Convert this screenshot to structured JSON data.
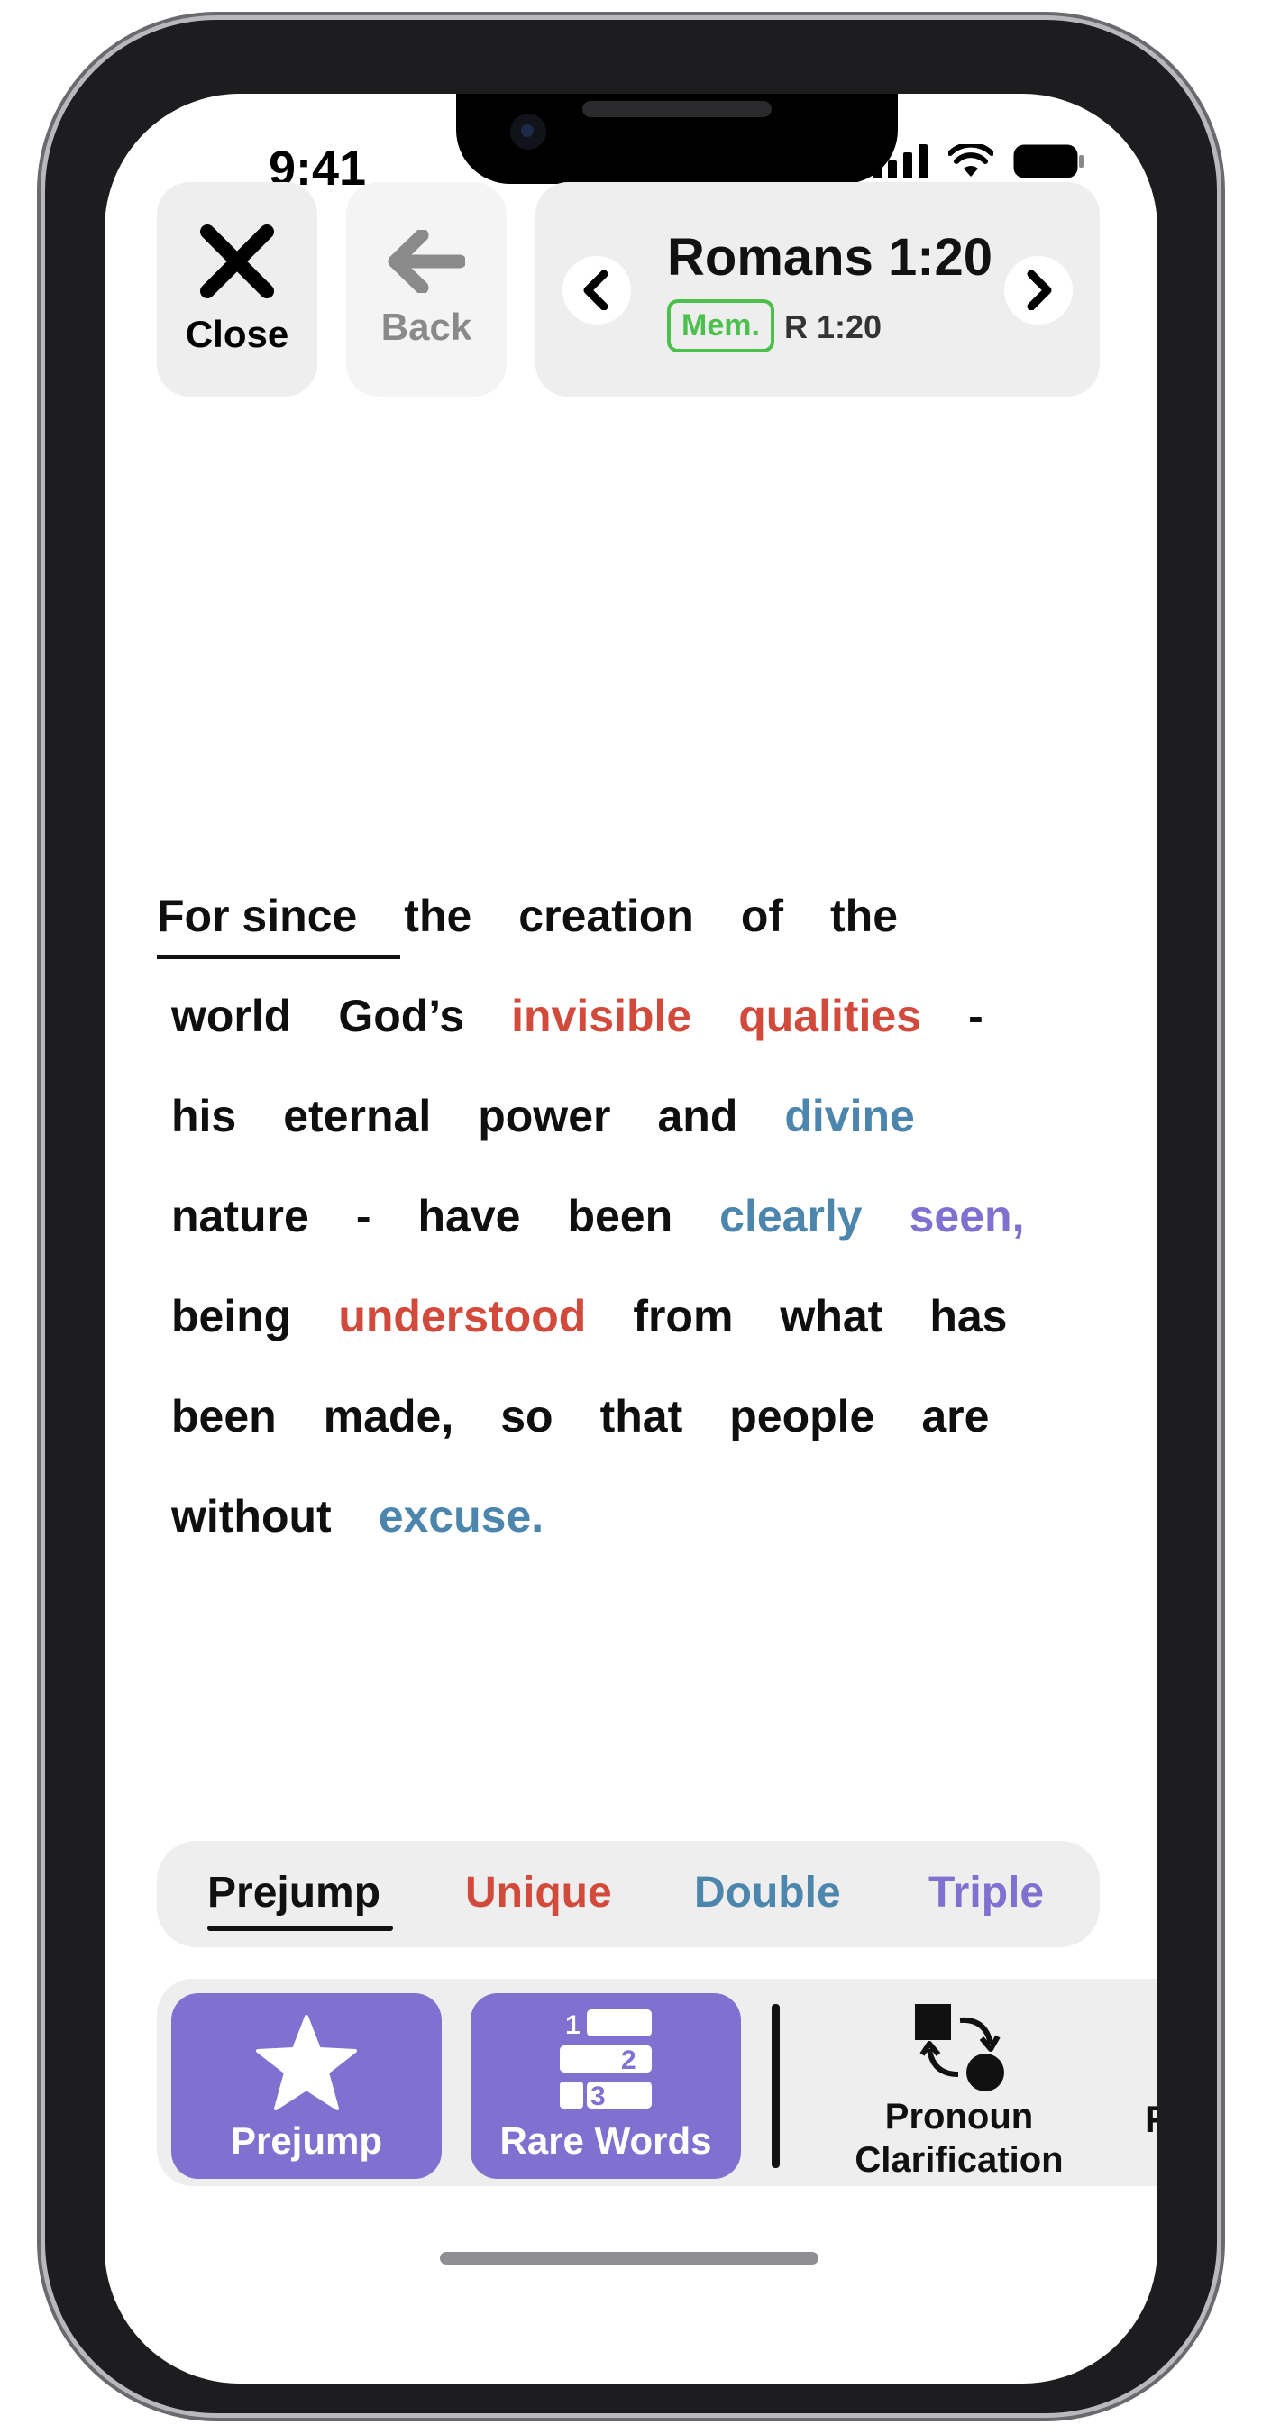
{
  "status_bar": {
    "time": "9:41"
  },
  "header": {
    "close_label": "Close",
    "back_label": "Back",
    "reference_title": "Romans 1:20",
    "memory_badge": "Mem.",
    "reference_sub": "R 1:20"
  },
  "verse": {
    "lines": [
      [
        {
          "t": "For since"
        },
        {
          "t": "the"
        },
        {
          "t": "creation"
        },
        {
          "t": "of"
        },
        {
          "t": "the"
        }
      ],
      [
        {
          "t": "world"
        },
        {
          "t": "God’s"
        },
        {
          "t": "invisible",
          "c": "red"
        },
        {
          "t": "qualities",
          "c": "red"
        },
        {
          "t": "-"
        }
      ],
      [
        {
          "t": "his"
        },
        {
          "t": "eternal"
        },
        {
          "t": "power"
        },
        {
          "t": "and"
        },
        {
          "t": "divine",
          "c": "blue"
        }
      ],
      [
        {
          "t": "nature"
        },
        {
          "t": "-"
        },
        {
          "t": "have"
        },
        {
          "t": "been"
        },
        {
          "t": "clearly",
          "c": "blue"
        },
        {
          "t": "seen,",
          "c": "purple"
        }
      ],
      [
        {
          "t": "being"
        },
        {
          "t": "understood",
          "c": "red"
        },
        {
          "t": "from"
        },
        {
          "t": "what"
        },
        {
          "t": "has"
        }
      ],
      [
        {
          "t": "been"
        },
        {
          "t": "made,"
        },
        {
          "t": "so"
        },
        {
          "t": "that"
        },
        {
          "t": "people"
        },
        {
          "t": "are"
        }
      ],
      [
        {
          "t": "without"
        },
        {
          "t": "excuse.",
          "c": "blue"
        }
      ]
    ]
  },
  "tabs": {
    "prejump": "Prejump",
    "unique": "Unique",
    "double": "Double",
    "triple": "Triple"
  },
  "tools": {
    "prejump_label": "Prejump",
    "rare_words_label": "Rare Words",
    "rare_numbers": [
      "1",
      "2",
      "3"
    ],
    "pronoun_label_1": "Pronoun",
    "pronoun_label_2": "Clarification",
    "next_partial": "F"
  },
  "colors": {
    "accent_purple": "#8070d0",
    "unique_red": "#d24a3c",
    "double_blue": "#4c86ad",
    "triple_purple": "#8170d0",
    "memorized_green": "#4cc04c"
  },
  "icons": [
    "close-icon",
    "back-arrow-icon",
    "chevron-left-icon",
    "chevron-right-icon",
    "star-icon",
    "rare-words-icon",
    "pronoun-swap-icon",
    "signal-icon",
    "wifi-icon",
    "battery-icon"
  ]
}
